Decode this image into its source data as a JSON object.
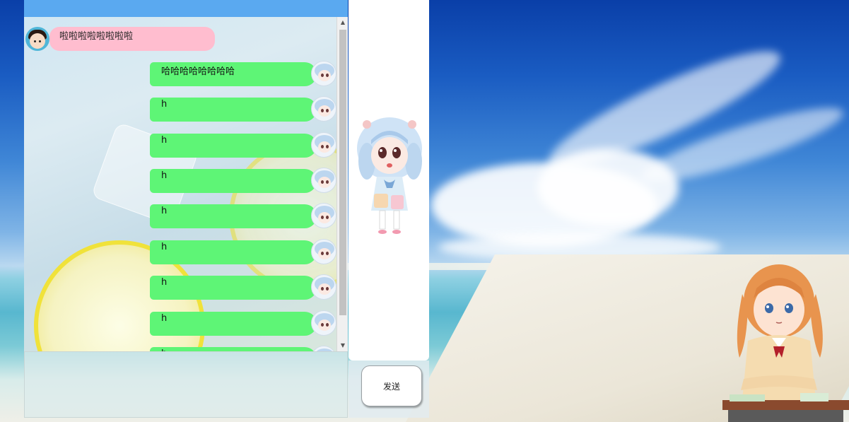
{
  "chat": {
    "incoming": [
      {
        "text": "啦啦啦啦啦啦啦啦"
      }
    ],
    "outgoing": [
      {
        "text": "哈哈哈哈哈哈哈哈"
      },
      {
        "text": "h"
      },
      {
        "text": "h"
      },
      {
        "text": "h"
      },
      {
        "text": "h"
      },
      {
        "text": "h"
      },
      {
        "text": "h"
      },
      {
        "text": "h"
      },
      {
        "text": "h"
      }
    ]
  },
  "input": {
    "value": "",
    "placeholder": ""
  },
  "send_button": {
    "label": "发送"
  },
  "colors": {
    "incoming_bubble": "#ffbdcf",
    "outgoing_bubble": "#5ef576",
    "header_bar": "#5aa9f0"
  },
  "icons": {
    "incoming_avatar": "girl-avatar-icon",
    "outgoing_avatar": "anime-avatar-icon",
    "scroll_up": "scroll-up-arrow-icon",
    "scroll_down": "scroll-down-arrow-icon"
  }
}
